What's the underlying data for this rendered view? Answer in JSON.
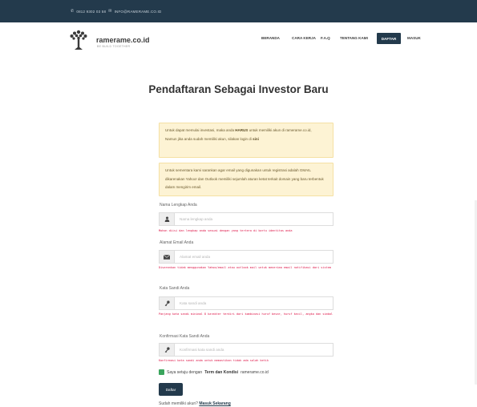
{
  "topbar": {
    "phone": "0812 9302 03 58",
    "email": "INFO@RAMERAME.CO.ID"
  },
  "brand": {
    "name": "ramerame.co.id",
    "tagline": "BE BUILD TOGETHER"
  },
  "nav": {
    "beranda": "BERANDA",
    "cara_kerja": "CARA KERJA",
    "faq": "F.A.Q",
    "tentang": "TENTANG KAMI",
    "daftar": "DAFTAR",
    "masuk": "MASUK"
  },
  "page_title": "Pendaftaran Sebagai Investor Baru",
  "alert1": {
    "p1": "Untuk dapat memulai investasi, maka anda ",
    "harus": "HARUS",
    "p2": " untuk memiliki akun di ramerame.co.id,",
    "line2_pre": "Namun jika anda sudah memiliki akun, silakan login di ",
    "sini": "sini"
  },
  "alert2": {
    "text": "Untuk sementara kami sarankan agar email yang digunakan untuk registrasi adalah GMAIL dikarenakan Yahoo! dan Outlook memiliki sejumlah aturan ketat terkait domain yang baru terbentuk dalam mengirim email."
  },
  "fields": {
    "name": {
      "label": "Nama Lengkap Anda",
      "placeholder": "Nama lengkap anda",
      "hint": "Mohon diisi dan lengkap anda sesuai dengan yang tertera di kartu identitas anda"
    },
    "email": {
      "label": "Alamat Email Anda",
      "placeholder": "Alamat email anda",
      "hint": "Disarankan tidak menggunakan Yahoo/email atau outlook mail untuk menerima email notifikasi dari sistem"
    },
    "password": {
      "label": "Kata Sandi Anda",
      "placeholder": "Kata sandi anda",
      "hint": "Panjang kata sandi minimal 8 karakter terdiri dari kombinasi huruf besar, huruf kecil, angka dan simbol"
    },
    "confirm": {
      "label": "Konfirmasi Kata Sandi Anda",
      "placeholder": "Konfirmasi kata sandi anda",
      "hint": "Konfirmasi kata sandi anda untuk memastikan tidak ada salah ketik"
    }
  },
  "agree": {
    "pre": "Saya setuju dengan ",
    "link": "Term dan Kondisi",
    "post": " ramerame.co.id"
  },
  "submit_label": "Daftar",
  "footer": {
    "pre": "Sudah memiliki akun? ",
    "link": "Masuk Sekarang"
  },
  "colors": {
    "navy": "#233a4c",
    "alert_bg": "#fdf3d4",
    "hint_red": "#d14",
    "check_green": "#3aa55d"
  }
}
